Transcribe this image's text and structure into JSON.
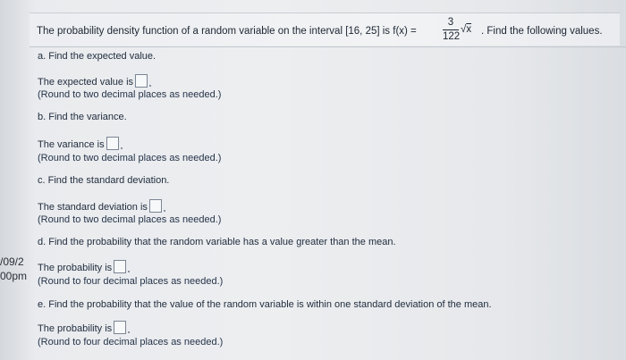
{
  "question": {
    "prefix": "The probability density function of a random variable on the interval [16, 25] is f(x) =",
    "fraction_numerator": "3",
    "fraction_denominator": "122",
    "radical_symbol": "√",
    "radicand": "x",
    "suffix": ". Find the following values."
  },
  "parts": [
    {
      "title": "a. Find the expected value.",
      "answer_label": "The expected value is",
      "hint": "(Round to two decimal places as needed.)"
    },
    {
      "title": "b. Find the variance.",
      "answer_label": "The variance is",
      "hint": "(Round to two decimal places as needed.)"
    },
    {
      "title": "c. Find the standard deviation.",
      "answer_label": "The standard deviation is",
      "hint": "(Round to two decimal places as needed.)"
    },
    {
      "title": "d. Find the probability that the random variable has a value greater than the mean.",
      "answer_label": "The probability is",
      "hint": "(Round to four decimal places as needed.)"
    },
    {
      "title": "e. Find the probability that the value of the random variable is within one standard deviation of the mean.",
      "answer_label": "The probability is",
      "hint": "(Round to four decimal places as needed.)"
    }
  ],
  "left_edge": {
    "date_fragment": "/09/2",
    "time_fragment": "00pm"
  }
}
